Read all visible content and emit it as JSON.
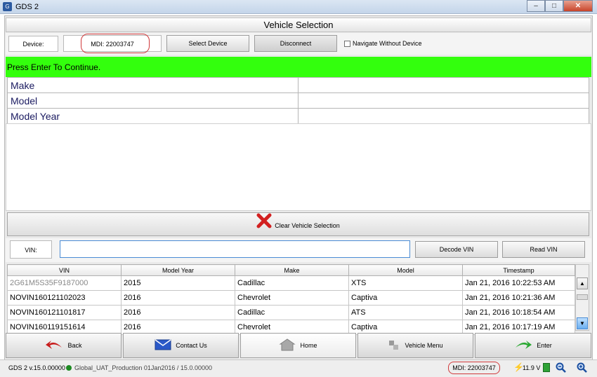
{
  "window": {
    "title": "GDS 2",
    "minimize": "–",
    "maximize": "□",
    "close": "✕"
  },
  "header": {
    "title": "Vehicle Selection"
  },
  "device": {
    "label": "Device:",
    "value": "MDI: 22003747",
    "select_button": "Select Device",
    "disconnect_button": "Disconnect",
    "navigate_label": "Navigate Without Device",
    "navigate_checked": false
  },
  "banner": {
    "text": "Press Enter To Continue.",
    "color": "#33ff0d"
  },
  "vehicle_fields": [
    {
      "label": "Make",
      "value": ""
    },
    {
      "label": "Model",
      "value": ""
    },
    {
      "label": "Model Year",
      "value": ""
    }
  ],
  "clear_button": "Clear Vehicle Selection",
  "vin": {
    "label": "VIN:",
    "value": "",
    "decode_button": "Decode VIN",
    "read_button": "Read VIN"
  },
  "history": {
    "columns": [
      "VIN",
      "Model Year",
      "Make",
      "Model",
      "Timestamp"
    ],
    "rows": [
      [
        "2G61M5S35F9187000",
        "2015",
        "Cadillac",
        "XTS",
        "Jan 21, 2016 10:22:53 AM"
      ],
      [
        "NOVIN160121102023",
        "2016",
        "Chevrolet",
        "Captiva",
        "Jan 21, 2016 10:21:36 AM"
      ],
      [
        "NOVIN160121101817",
        "2016",
        "Cadillac",
        "ATS",
        "Jan 21, 2016 10:18:54 AM"
      ],
      [
        "NOVIN160119151614",
        "2016",
        "Chevrolet",
        "Captiva",
        "Jan 21, 2016 10:17:19 AM"
      ]
    ]
  },
  "nav": {
    "back": "Back",
    "contact": "Contact Us",
    "home": "Home",
    "vehicle_menu": "Vehicle Menu",
    "enter": "Enter"
  },
  "status": {
    "version": "GDS 2 v.15.0.00000",
    "server": "Global_UAT_Production 01Jan2016 / 15.0.00000",
    "mdi": "MDI: 22003747",
    "voltage": "11.9 V"
  },
  "colors": {
    "accent": "#33ff0d",
    "highlight": "#d0383a"
  }
}
